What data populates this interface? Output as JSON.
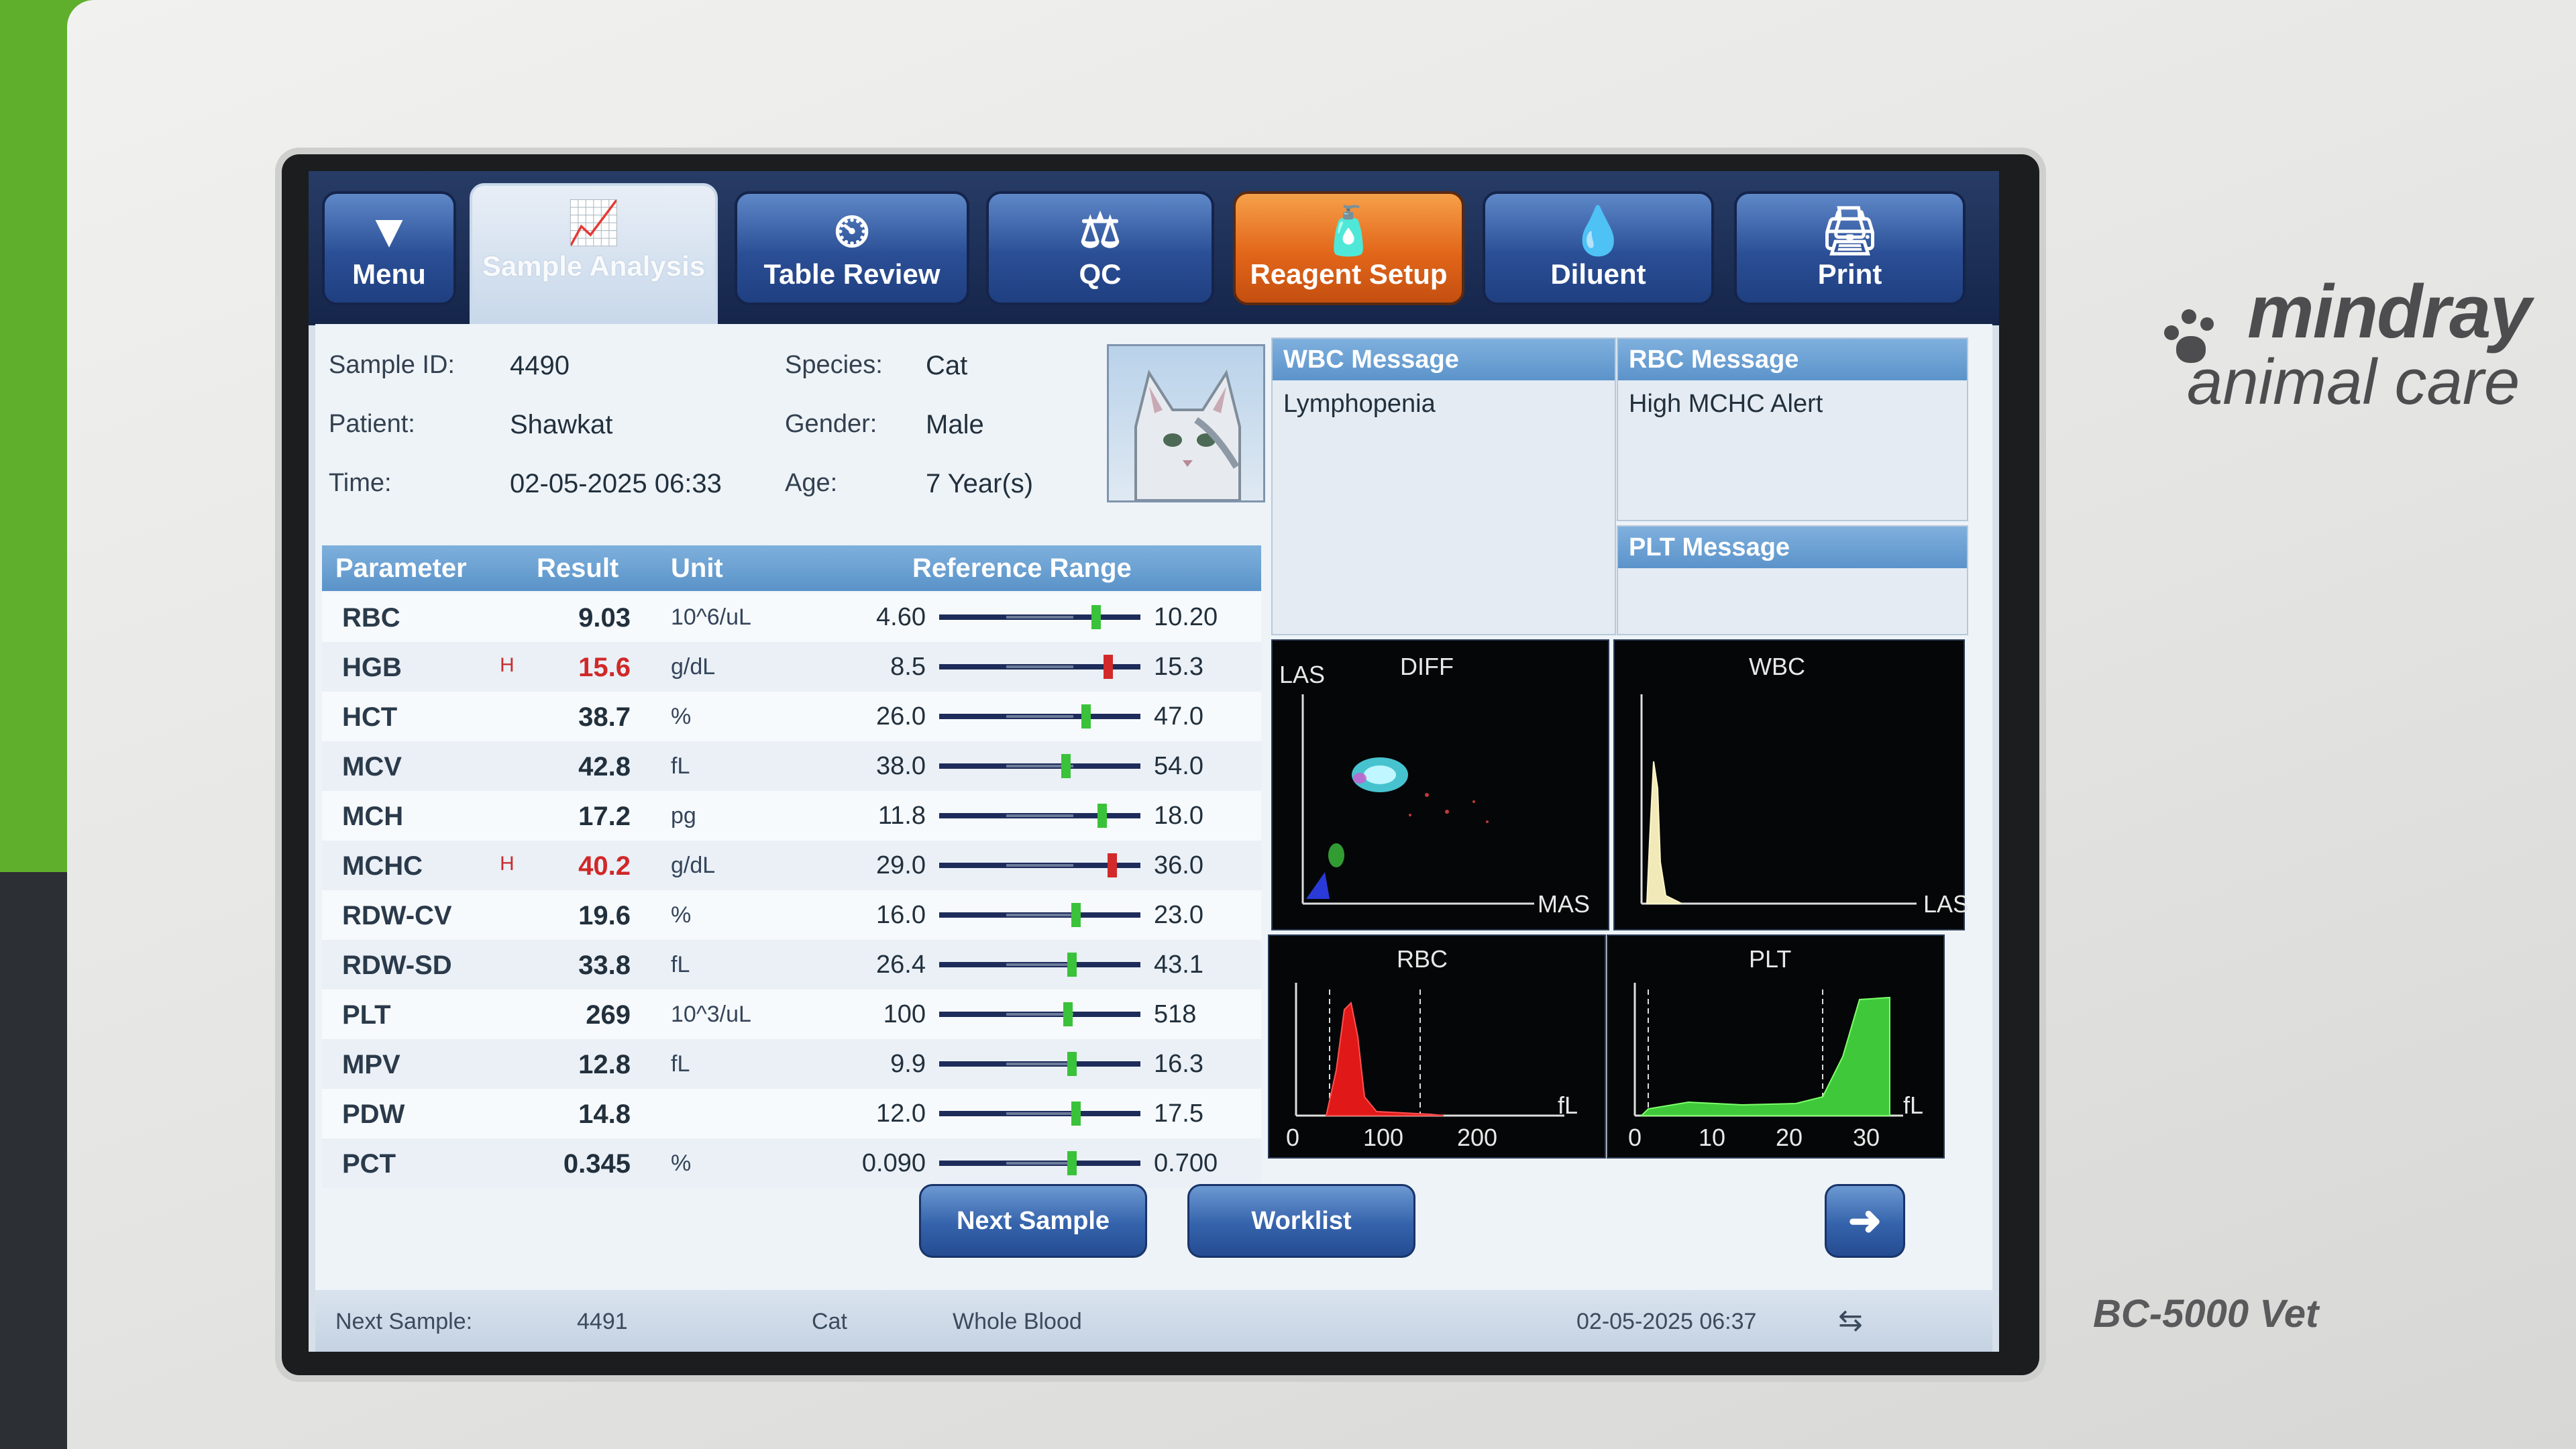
{
  "toolbar": {
    "menu": "Menu",
    "sample_analysis": "Sample Analysis",
    "table_review": "Table Review",
    "qc": "QC",
    "reagent_setup": "Reagent Setup",
    "diluent": "Diluent",
    "print": "Print"
  },
  "sample": {
    "id_label": "Sample ID:",
    "id": "4490",
    "patient_label": "Patient:",
    "patient": "Shawkat",
    "time_label": "Time:",
    "time": "02-05-2025 06:33",
    "species_label": "Species:",
    "species": "Cat",
    "gender_label": "Gender:",
    "gender": "Male",
    "age_label": "Age:",
    "age": "7 Year(s)"
  },
  "table": {
    "headers": {
      "parameter": "Parameter",
      "result": "Result",
      "unit": "Unit",
      "reference": "Reference Range"
    },
    "rows": [
      {
        "param": "RBC",
        "flag": "",
        "result": "9.03",
        "unit": "10^6/uL",
        "low": "4.60",
        "high": "10.20",
        "pos": 0.78,
        "status": "normal"
      },
      {
        "param": "HGB",
        "flag": "H",
        "result": "15.6",
        "unit": "g/dL",
        "low": "8.5",
        "high": "15.3",
        "pos": 0.84,
        "status": "high"
      },
      {
        "param": "HCT",
        "flag": "",
        "result": "38.7",
        "unit": "%",
        "low": "26.0",
        "high": "47.0",
        "pos": 0.73,
        "status": "normal"
      },
      {
        "param": "MCV",
        "flag": "",
        "result": "42.8",
        "unit": "fL",
        "low": "38.0",
        "high": "54.0",
        "pos": 0.63,
        "status": "normal"
      },
      {
        "param": "MCH",
        "flag": "",
        "result": "17.2",
        "unit": "pg",
        "low": "11.8",
        "high": "18.0",
        "pos": 0.81,
        "status": "normal"
      },
      {
        "param": "MCHC",
        "flag": "H",
        "result": "40.2",
        "unit": "g/dL",
        "low": "29.0",
        "high": "36.0",
        "pos": 0.86,
        "status": "high"
      },
      {
        "param": "RDW-CV",
        "flag": "",
        "result": "19.6",
        "unit": "%",
        "low": "16.0",
        "high": "23.0",
        "pos": 0.68,
        "status": "normal"
      },
      {
        "param": "RDW-SD",
        "flag": "",
        "result": "33.8",
        "unit": "fL",
        "low": "26.4",
        "high": "43.1",
        "pos": 0.66,
        "status": "normal"
      },
      {
        "param": "PLT",
        "flag": "",
        "result": "269",
        "unit": "10^3/uL",
        "low": "100",
        "high": "518",
        "pos": 0.64,
        "status": "normal"
      },
      {
        "param": "MPV",
        "flag": "",
        "result": "12.8",
        "unit": "fL",
        "low": "9.9",
        "high": "16.3",
        "pos": 0.66,
        "status": "normal"
      },
      {
        "param": "PDW",
        "flag": "",
        "result": "14.8",
        "unit": "",
        "low": "12.0",
        "high": "17.5",
        "pos": 0.68,
        "status": "normal"
      },
      {
        "param": "PCT",
        "flag": "",
        "result": "0.345",
        "unit": "%",
        "low": "0.090",
        "high": "0.700",
        "pos": 0.66,
        "status": "normal"
      }
    ]
  },
  "messages": {
    "wbc_title": "WBC Message",
    "wbc_text": "Lymphopenia",
    "rbc_title": "RBC Message",
    "rbc_text": "High MCHC Alert",
    "plt_title": "PLT Message",
    "plt_text": ""
  },
  "plots": {
    "diff": {
      "title": "DIFF",
      "y_label": "LAS",
      "x_label": "MAS"
    },
    "wbc": {
      "title": "WBC",
      "x_label": "LAS"
    },
    "rbc": {
      "title": "RBC",
      "unit": "fL",
      "ticks": [
        "0",
        "100",
        "200"
      ]
    },
    "plt": {
      "title": "PLT",
      "unit": "fL",
      "ticks": [
        "0",
        "10",
        "20",
        "30"
      ]
    }
  },
  "buttons": {
    "next_sample": "Next Sample",
    "worklist": "Worklist"
  },
  "status": {
    "label": "Next Sample:",
    "id": "4491",
    "species": "Cat",
    "mode": "Whole Blood",
    "datetime": "02-05-2025 06:37"
  },
  "device": {
    "brand_top": "mindray",
    "brand_bottom": "animal care",
    "model": "BC-5000 Vet"
  },
  "colors": {
    "high": "#d02828",
    "normal_marker": "#3ac23a",
    "high_marker": "#d22a2a",
    "reagent_tab": "#e2661a"
  }
}
